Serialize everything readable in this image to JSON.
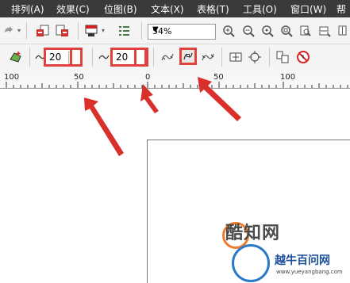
{
  "menu": {
    "items": [
      "排列(A)",
      "效果(C)",
      "位图(B)",
      "文本(X)",
      "表格(T)",
      "工具(O)",
      "窗口(W)",
      "帮"
    ]
  },
  "toolbar": {
    "zoom_value": "54%"
  },
  "property_bar": {
    "field1_value": "20",
    "field2_value": "20"
  },
  "ruler": {
    "labels": [
      "100",
      "50",
      "0",
      "50",
      "100"
    ]
  },
  "watermark": {
    "line1": "酷知网",
    "line2": "越牛百问网",
    "url": "www.yueyangbang.com"
  },
  "colors": {
    "menubar": "#3a3a3a",
    "highlight": "#e0413d",
    "arrow": "#d9302b"
  }
}
